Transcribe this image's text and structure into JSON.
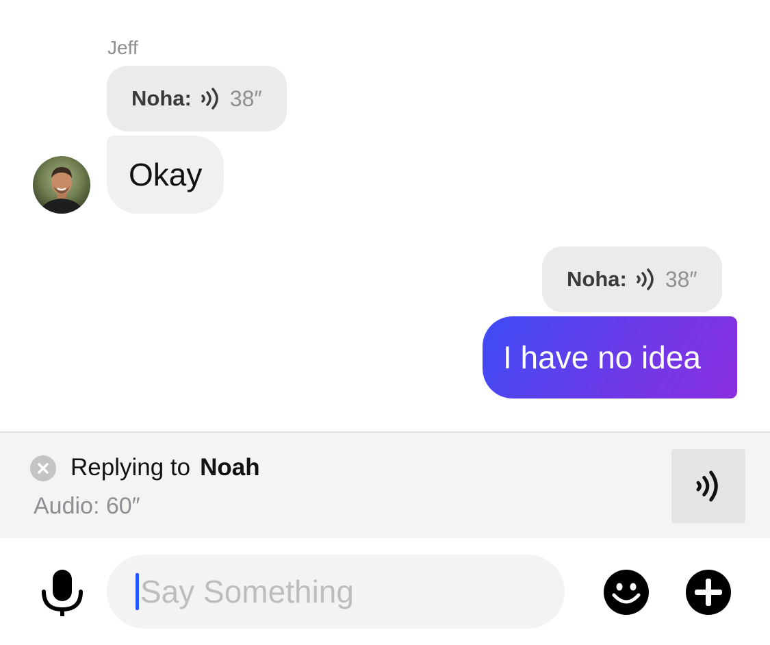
{
  "conversation": {
    "sender_name": "Jeff",
    "incoming": {
      "quote": {
        "name": "Noha:",
        "duration": "38″",
        "icon": "audio-wave-icon"
      },
      "text": "Okay"
    },
    "outgoing": {
      "quote": {
        "name": "Noha:",
        "duration": "38″",
        "icon": "audio-wave-icon"
      },
      "text": "I have no idea"
    }
  },
  "reply": {
    "prefix": "Replying to",
    "name": "Noah",
    "subtitle": "Audio: 60″",
    "close_icon": "close-icon",
    "thumb_icon": "audio-wave-icon"
  },
  "composer": {
    "placeholder": "Say Something",
    "mic_icon": "microphone-icon",
    "emoji_icon": "emoji-icon",
    "add_icon": "plus-icon"
  },
  "colors": {
    "bubble_gradient_start": "#3d4cf5",
    "bubble_gradient_end": "#8a2fe0",
    "caret": "#2457ff"
  }
}
